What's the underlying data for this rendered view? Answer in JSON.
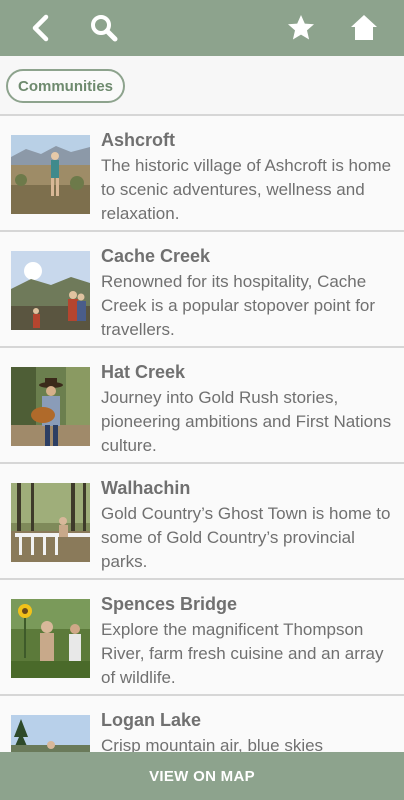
{
  "header": {
    "back_icon": "chevron-left-icon",
    "search_icon": "search-icon",
    "favorites_icon": "star-icon",
    "home_icon": "home-icon",
    "color": "#8da38d"
  },
  "filter": {
    "chip_label": "Communities"
  },
  "communities": [
    {
      "title": "Ashcroft",
      "description": "The historic village of Ashcroft is home to scenic adventures, wellness and relaxation."
    },
    {
      "title": "Cache Creek",
      "description": "Renowned for its hospitality, Cache Creek is a popular stopover point for travellers."
    },
    {
      "title": "Hat Creek",
      "description": "Journey into Gold Rush stories, pioneering ambitions and First Nations culture."
    },
    {
      "title": "Walhachin",
      "description": "Gold Country’s Ghost Town is home to some of Gold Country’s provincial parks."
    },
    {
      "title": "Spences Bridge",
      "description": "Explore the magnificent Thompson River, farm fresh cuisine and an array of wildlife."
    },
    {
      "title": "Logan Lake",
      "description": "Crisp mountain air, blue skies"
    }
  ],
  "footer": {
    "map_button_label": "VIEW ON MAP"
  }
}
